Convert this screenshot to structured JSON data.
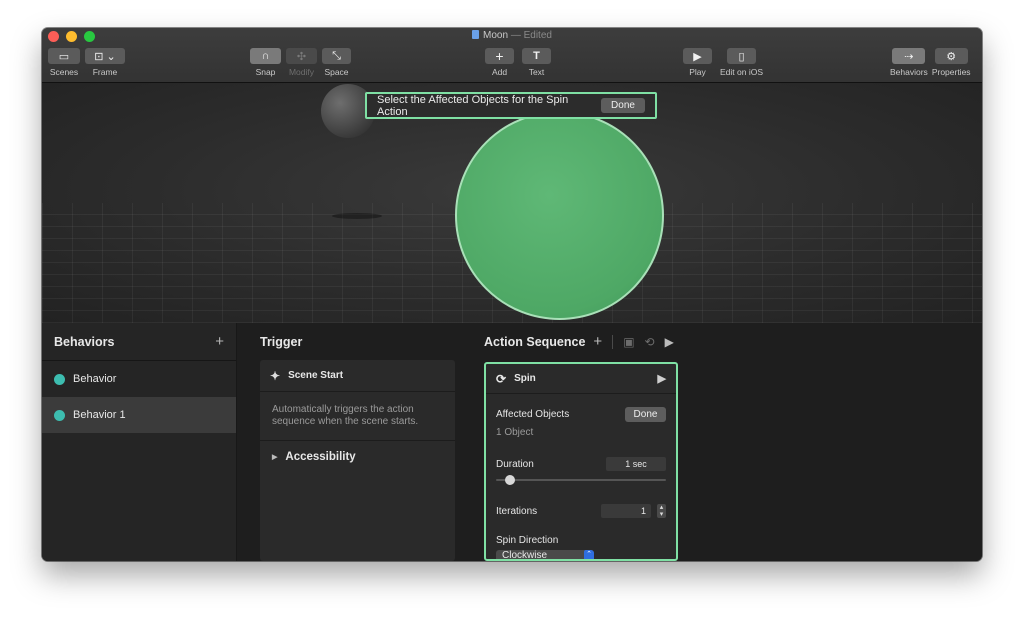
{
  "window": {
    "title": "Moon",
    "title_suffix": " — Edited"
  },
  "toolbar": {
    "scenes_label": "Scenes",
    "frame_label": "Frame",
    "snap_label": "Snap",
    "modify_label": "Modify",
    "space_label": "Space",
    "add_label": "Add",
    "text_label": "Text",
    "play_label": "Play",
    "edit_ios_label": "Edit on iOS",
    "behaviors_label": "Behaviors",
    "properties_label": "Properties"
  },
  "banner": {
    "text": "Select the Affected Objects for the Spin Action",
    "done_label": "Done"
  },
  "sidebar": {
    "title": "Behaviors",
    "items": [
      {
        "label": "Behavior"
      },
      {
        "label": "Behavior 1"
      }
    ]
  },
  "trigger": {
    "title": "Trigger",
    "card_title": "Scene Start",
    "description": "Automatically triggers the action sequence when the scene starts.",
    "accessibility_label": "Accessibility"
  },
  "action": {
    "title": "Action Sequence",
    "card_title": "Spin",
    "affected_label": "Affected Objects",
    "affected_done": "Done",
    "affected_count": "1 Object",
    "duration_label": "Duration",
    "duration_value": "1 sec",
    "duration_slider_fraction": 0.05,
    "iterations_label": "Iterations",
    "iterations_value": "1",
    "direction_label": "Spin Direction",
    "direction_value": "Clockwise"
  },
  "colors": {
    "selection_green": "#7fe0a4",
    "sphere_green": "#4ea865",
    "behavior_dot": "#3dbdb0"
  }
}
